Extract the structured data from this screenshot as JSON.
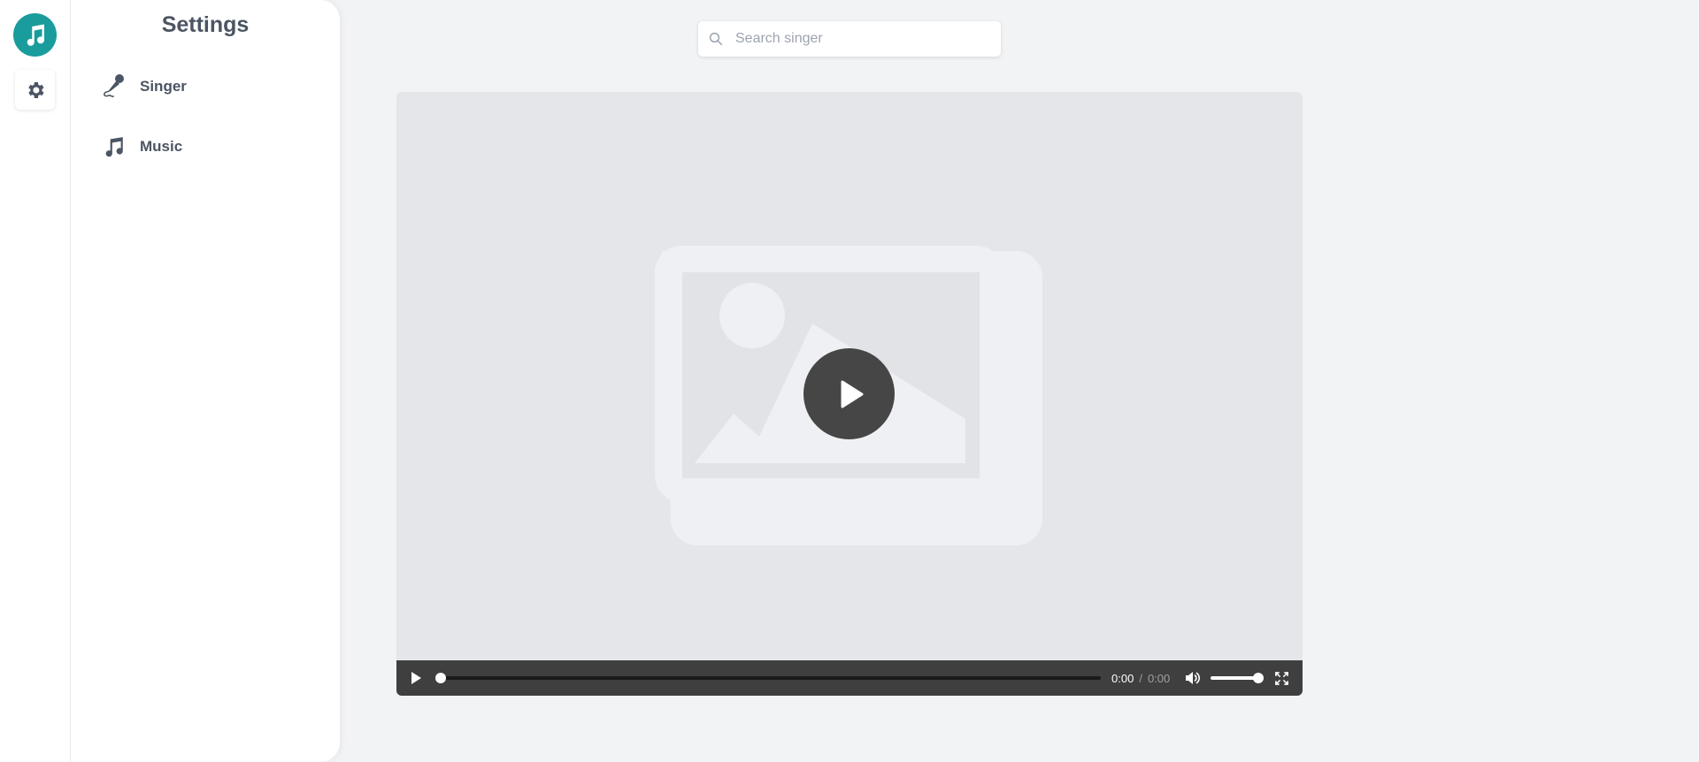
{
  "theme": {
    "accent": "#1a9c9c",
    "text": "#4b5563",
    "background": "#f2f3f5",
    "player_bar": "#3f3f3f"
  },
  "rail": {
    "logo_icon": "music-note-icon",
    "settings_icon": "gear-icon"
  },
  "panel": {
    "title": "Settings",
    "items": [
      {
        "label": "Singer",
        "icon": "microphone-icon"
      },
      {
        "label": "Music",
        "icon": "music-note-icon"
      }
    ]
  },
  "search": {
    "placeholder": "Search singer",
    "value": ""
  },
  "player": {
    "current_time": "0:00",
    "separator": "/",
    "duration": "0:00",
    "progress": 0,
    "volume": 1.0
  }
}
